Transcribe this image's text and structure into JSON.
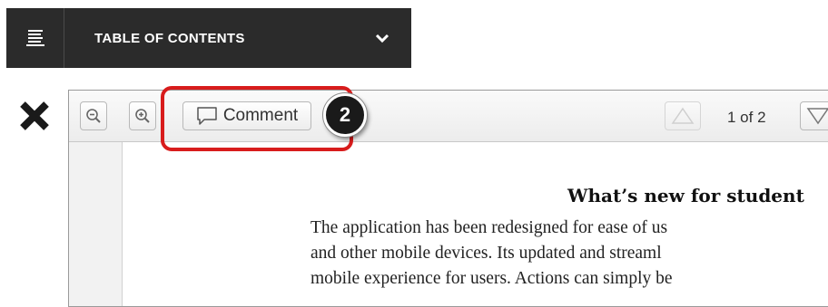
{
  "toc": {
    "title": "TABLE OF CONTENTS",
    "menu_icon": "hamburger-list-icon",
    "chevron_icon": "chevron-down-icon"
  },
  "close_icon": "close-x-icon",
  "toolbar": {
    "zoom_out_icon": "zoom-out-icon",
    "zoom_in_icon": "zoom-in-icon",
    "comment_label": "Comment",
    "comment_icon": "speech-bubble-icon",
    "page_indicator": "1 of 2",
    "prev_icon": "triangle-up-icon",
    "next_icon": "triangle-down-icon"
  },
  "callout": {
    "step_number": "2",
    "highlight_color": "#d81c1c"
  },
  "document": {
    "heading": "What’s new for student",
    "lines": [
      "The application has been redesigned for ease of us",
      "and other mobile devices. Its updated and streaml",
      "mobile experience for users. Actions can simply be"
    ]
  },
  "colors": {
    "toc_background": "#2b2b2b",
    "badge_background": "#1a1a1a"
  }
}
